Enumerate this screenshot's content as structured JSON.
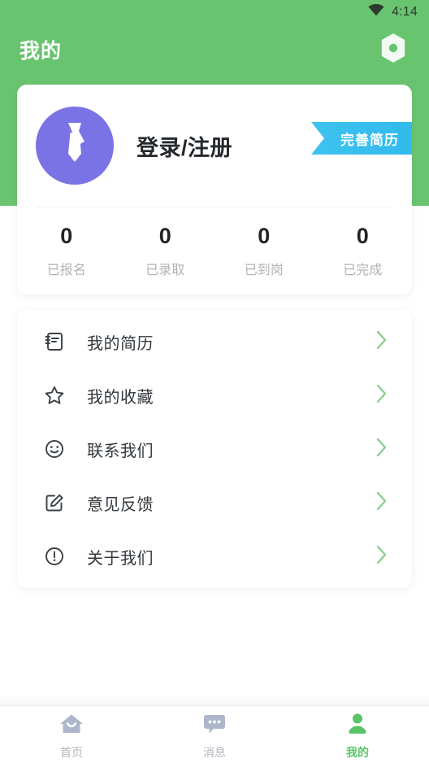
{
  "status_bar": {
    "wifi_icon": "wifi-icon",
    "time": "4:14"
  },
  "app_bar": {
    "title": "我的",
    "settings_icon": "hexagon-gear-icon"
  },
  "profile": {
    "avatar_icon": "necktie-avatar-icon",
    "login_label": "登录/注册",
    "badge_label": "完善简历",
    "stats": [
      {
        "value": "0",
        "label": "已报名"
      },
      {
        "value": "0",
        "label": "已录取"
      },
      {
        "value": "0",
        "label": "已到岗"
      },
      {
        "value": "0",
        "label": "已完成"
      }
    ]
  },
  "menu": {
    "items": [
      {
        "icon": "resume-notebook-icon",
        "label": "我的简历"
      },
      {
        "icon": "star-icon",
        "label": "我的收藏"
      },
      {
        "icon": "smiley-icon",
        "label": "联系我们"
      },
      {
        "icon": "edit-square-icon",
        "label": "意见反馈"
      },
      {
        "icon": "exclamation-circle-icon",
        "label": "关于我们"
      }
    ],
    "chevron_icon": "chevron-right-icon"
  },
  "tab_bar": {
    "tabs": [
      {
        "icon": "home-icon",
        "label": "首页",
        "active": false
      },
      {
        "icon": "message-bubble-icon",
        "label": "消息",
        "active": false
      },
      {
        "icon": "person-icon",
        "label": "我的",
        "active": true
      }
    ]
  },
  "colors": {
    "header_green": "#69c46f",
    "accent_green": "#5bc46a",
    "badge_blue": "#36bdee",
    "avatar_purple": "#7a73e6",
    "chevron_green": "#8ccf90",
    "tab_inactive": "#aeb6cb"
  }
}
